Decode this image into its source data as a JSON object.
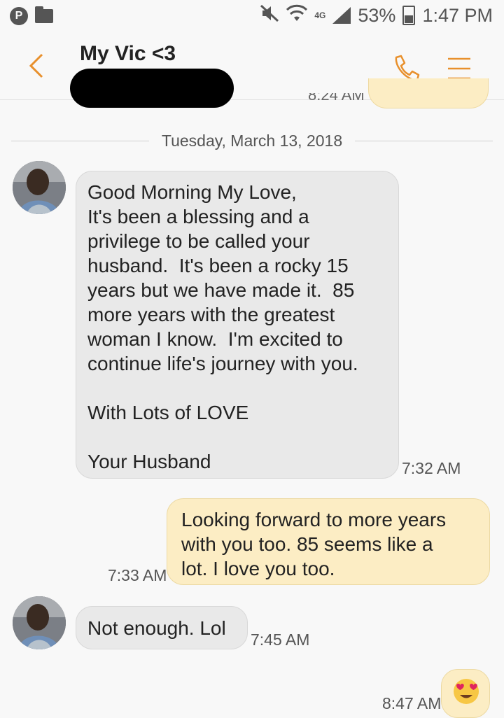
{
  "status_bar": {
    "battery": "53%",
    "time": "1:47 PM",
    "network": "4G"
  },
  "header": {
    "contact_name": "My Vic <3"
  },
  "partial_message": {
    "time": "8:24 AM"
  },
  "date_divider": "Tuesday, March 13, 2018",
  "messages": [
    {
      "direction": "incoming",
      "text": "Good Morning My Love,\nIt's been a blessing and a\nprivilege to be called your\nhusband.  It's been a rocky 15\nyears but we have made it.  85\nmore years with the greatest\nwoman I know.  I'm excited to\ncontinue life's journey with you.\n\nWith Lots of LOVE\n\nYour Husband",
      "time": "7:32 AM"
    },
    {
      "direction": "outgoing",
      "text": "Looking forward to more years\nwith you too. 85 seems like a\nlot. I love you too.",
      "time": "7:33 AM"
    },
    {
      "direction": "incoming",
      "text": "Not enough. Lol",
      "time": "7:45 AM"
    },
    {
      "direction": "outgoing",
      "text": "😍",
      "time": "8:47 AM"
    }
  ],
  "colors": {
    "accent": "#e8902c",
    "incoming_bubble": "#e9e9e9",
    "outgoing_bubble": "#fcedc4",
    "background": "#f8f8f8"
  },
  "icons": {
    "back": "chevron-left-icon",
    "call": "phone-icon",
    "menu": "hamburger-menu-icon"
  }
}
